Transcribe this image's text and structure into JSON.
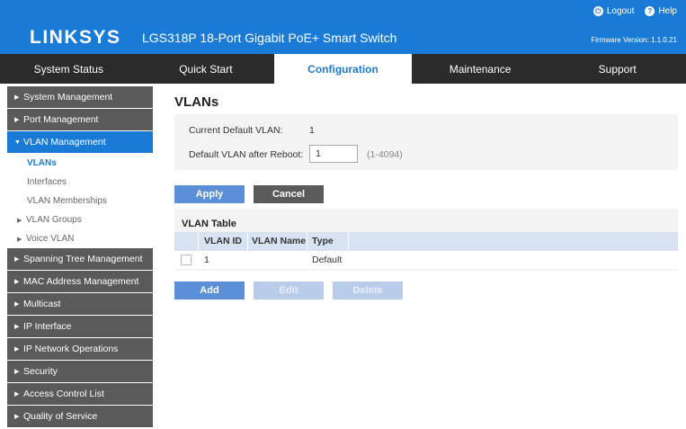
{
  "header": {
    "logo": "LINKSYS",
    "product": "LGS318P 18-Port Gigabit PoE+ Smart Switch",
    "logout_label": "Logout",
    "help_label": "Help",
    "firmware": "Firmware Version: 1.1.0.21"
  },
  "nav": {
    "tabs": [
      {
        "label": "System Status"
      },
      {
        "label": "Quick Start"
      },
      {
        "label": "Configuration"
      },
      {
        "label": "Maintenance"
      },
      {
        "label": "Support"
      }
    ]
  },
  "sidebar": {
    "system_management": "System Management",
    "port_management": "Port Management",
    "vlan_management": "VLAN Management",
    "vlans": "VLANs",
    "interfaces": "Interfaces",
    "vlan_memberships": "VLAN Memberships",
    "vlan_groups": "VLAN Groups",
    "voice_vlan": "Voice VLAN",
    "spanning_tree": "Spanning Tree Management",
    "mac_address": "MAC Address Management",
    "multicast": "Multicast",
    "ip_interface": "IP Interface",
    "ip_network_ops": "IP Network Operations",
    "security": "Security",
    "acl": "Access Control List",
    "qos": "Quality of Service"
  },
  "main": {
    "title": "VLANs",
    "current_default_label": "Current Default VLAN:",
    "current_default_value": "1",
    "after_reboot_label": "Default VLAN after Reboot:",
    "after_reboot_value": "1",
    "after_reboot_hint": "(1-4094)",
    "apply_label": "Apply",
    "cancel_label": "Cancel",
    "table": {
      "title": "VLAN Table",
      "columns": [
        "VLAN ID",
        "VLAN Name",
        "Type"
      ],
      "rows": [
        {
          "id": "1",
          "name": "",
          "type": "Default"
        }
      ]
    },
    "add_label": "Add",
    "edit_label": "Edit",
    "delete_label": "Delete"
  },
  "colors": {
    "brand_blue": "#1a7bd6",
    "nav_dark": "#2b2b2b",
    "sidebar_gray": "#5a5a5a",
    "button_blue": "#5b8fd8"
  }
}
